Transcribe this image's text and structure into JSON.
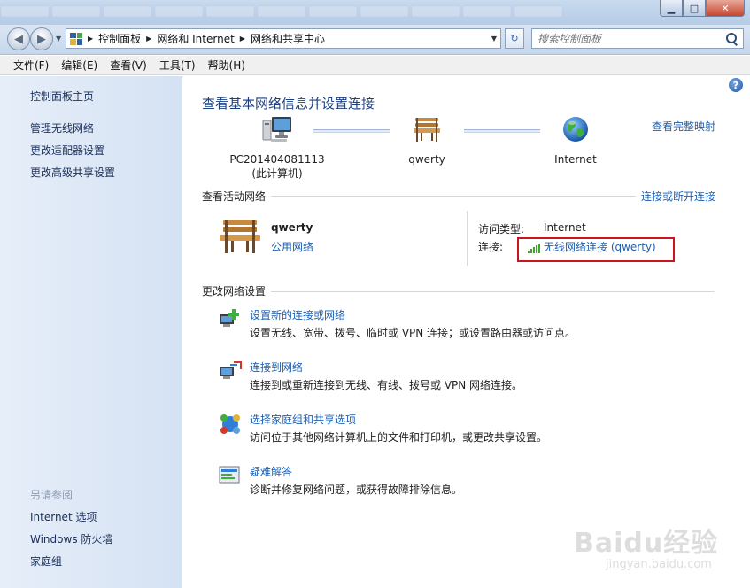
{
  "window": {
    "minimize_glyph": "▁",
    "maximize_glyph": "□",
    "close_glyph": "✕"
  },
  "nav": {
    "back_glyph": "◀",
    "forward_glyph": "▶",
    "refresh_glyph": "↻"
  },
  "breadcrumbs": [
    "控制面板",
    "网络和 Internet",
    "网络和共享中心"
  ],
  "search": {
    "placeholder": "搜索控制面板"
  },
  "menu": [
    "文件(F)",
    "编辑(E)",
    "查看(V)",
    "工具(T)",
    "帮助(H)"
  ],
  "sidebar": {
    "home": "控制面板主页",
    "links": [
      "管理无线网络",
      "更改适配器设置",
      "更改高级共享设置"
    ],
    "see_also_heading": "另请参阅",
    "see_also": [
      "Internet 选项",
      "Windows 防火墙",
      "家庭组"
    ]
  },
  "main": {
    "title": "查看基本网络信息并设置连接",
    "full_map_link": "查看完整映射",
    "help_glyph": "?",
    "nodes": {
      "computer_line1": "PC201404081113",
      "computer_line2": "(此计算机)",
      "network": "qwerty",
      "internet": "Internet"
    },
    "active": {
      "heading": "查看活动网络",
      "connect_link": "连接或断开连接",
      "name": "qwerty",
      "type": "公用网络",
      "access_type_label": "访问类型:",
      "access_type_value": "Internet",
      "connections_label": "连接:",
      "connection_link": "无线网络连接 (qwerty)"
    },
    "change": {
      "heading": "更改网络设置",
      "tasks": [
        {
          "title": "设置新的连接或网络",
          "desc": "设置无线、宽带、拨号、临时或 VPN 连接；或设置路由器或访问点。"
        },
        {
          "title": "连接到网络",
          "desc": "连接到或重新连接到无线、有线、拨号或 VPN 网络连接。"
        },
        {
          "title": "选择家庭组和共享选项",
          "desc": "访问位于其他网络计算机上的文件和打印机，或更改共享设置。"
        },
        {
          "title": "疑难解答",
          "desc": "诊断并修复网络问题，或获得故障排除信息。"
        }
      ]
    }
  },
  "watermark": {
    "main": "Baidu经验",
    "sub": "jingyan.baidu.com"
  },
  "colors": {
    "link": "#1d5fb2",
    "title": "#1c3f80",
    "highlight": "#c8141c",
    "signal": "#3fa52d"
  }
}
